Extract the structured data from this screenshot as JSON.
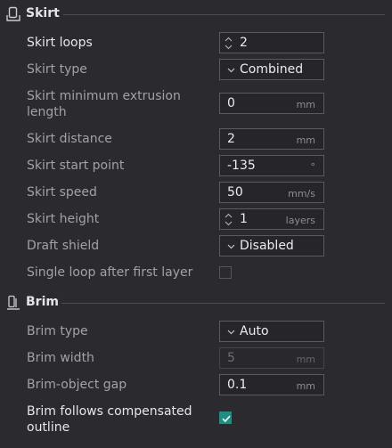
{
  "skirt": {
    "title": "Skirt",
    "icon": "skirt-icon",
    "settings": {
      "loops": {
        "label": "Skirt loops",
        "value": "2"
      },
      "type": {
        "label": "Skirt type",
        "value": "Combined"
      },
      "min_extrusion": {
        "label": "Skirt minimum extrusion length",
        "value": "0",
        "unit": "mm"
      },
      "distance": {
        "label": "Skirt distance",
        "value": "2",
        "unit": "mm"
      },
      "start_point": {
        "label": "Skirt start point",
        "value": "-135",
        "unit": "°"
      },
      "speed": {
        "label": "Skirt speed",
        "value": "50",
        "unit": "mm/s"
      },
      "height": {
        "label": "Skirt height",
        "value": "1",
        "unit": "layers"
      },
      "draft_shield": {
        "label": "Draft shield",
        "value": "Disabled"
      },
      "single_loop": {
        "label": "Single loop after first layer",
        "checked": false
      }
    }
  },
  "brim": {
    "title": "Brim",
    "icon": "brim-icon",
    "settings": {
      "type": {
        "label": "Brim type",
        "value": "Auto"
      },
      "width": {
        "label": "Brim width",
        "value": "5",
        "unit": "mm",
        "disabled": true
      },
      "object_gap": {
        "label": "Brim-object gap",
        "value": "0.1",
        "unit": "mm"
      },
      "follows_outline": {
        "label": "Brim follows compensated outline",
        "checked": true
      }
    }
  },
  "colors": {
    "background": "#2b2b2f",
    "accent": "#1c8f82",
    "field_border": "#5a5b61",
    "text_primary": "#e6e7ea",
    "text_secondary": "#a0a2a9"
  }
}
